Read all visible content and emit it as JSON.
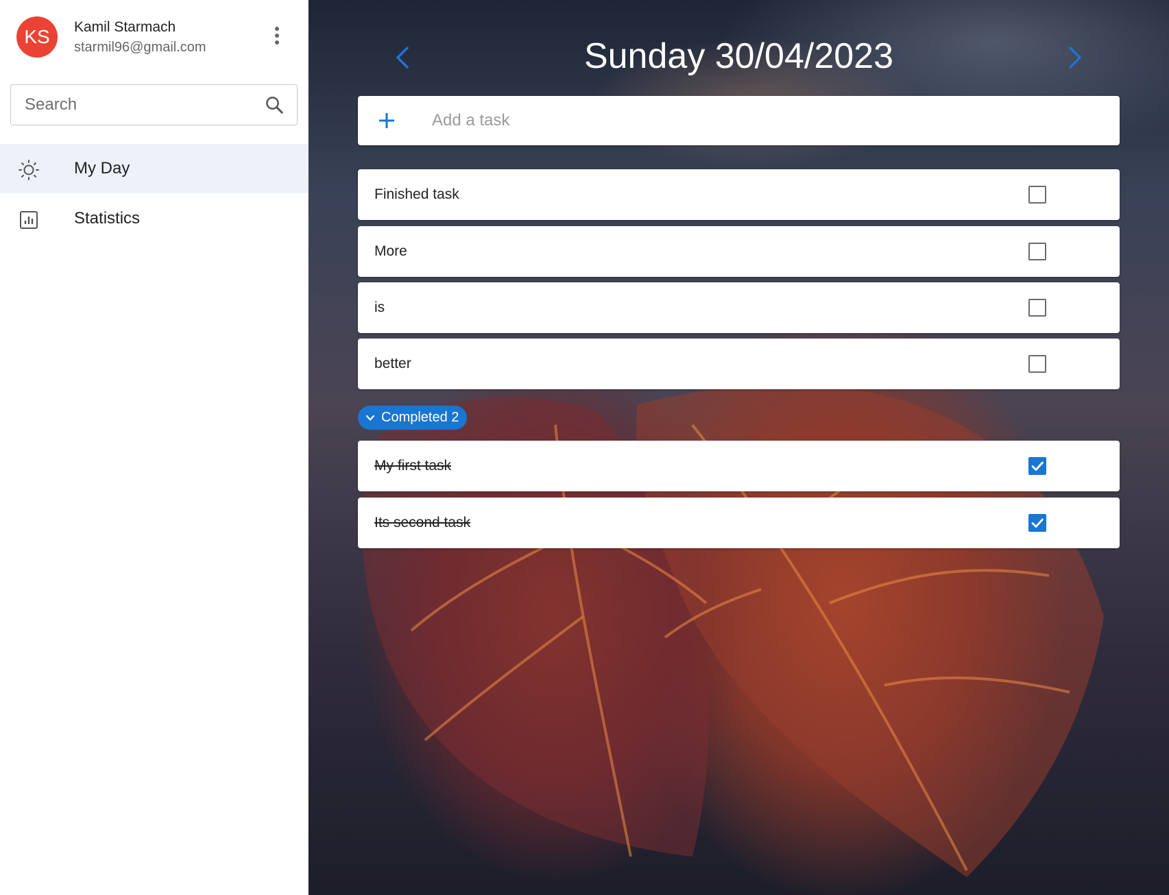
{
  "profile": {
    "initials": "KS",
    "name": "Kamil Starmach",
    "email": "starmil96@gmail.com",
    "avatar_color": "#ea4335"
  },
  "search": {
    "placeholder": "Search",
    "value": ""
  },
  "sidebar": {
    "items": [
      {
        "label": "My Day",
        "icon": "sun-icon",
        "active": true
      },
      {
        "label": "Statistics",
        "icon": "bar-chart-icon",
        "active": false
      }
    ]
  },
  "header": {
    "date_title": "Sunday 30/04/2023",
    "prev_icon": "chevron-left-icon",
    "next_icon": "chevron-right-icon"
  },
  "add_task": {
    "placeholder": "Add a task",
    "value": ""
  },
  "tasks": [
    {
      "label": "Finished task",
      "done": false
    },
    {
      "label": "More",
      "done": false
    },
    {
      "label": "is",
      "done": false
    },
    {
      "label": "better",
      "done": false
    }
  ],
  "completed": {
    "label": "Completed 2",
    "expanded": true,
    "tasks": [
      {
        "label": "My first task",
        "done": true
      },
      {
        "label": "Its second task",
        "done": true
      }
    ]
  },
  "colors": {
    "accent": "#1976d2",
    "active_nav_bg": "#edf2fa"
  }
}
